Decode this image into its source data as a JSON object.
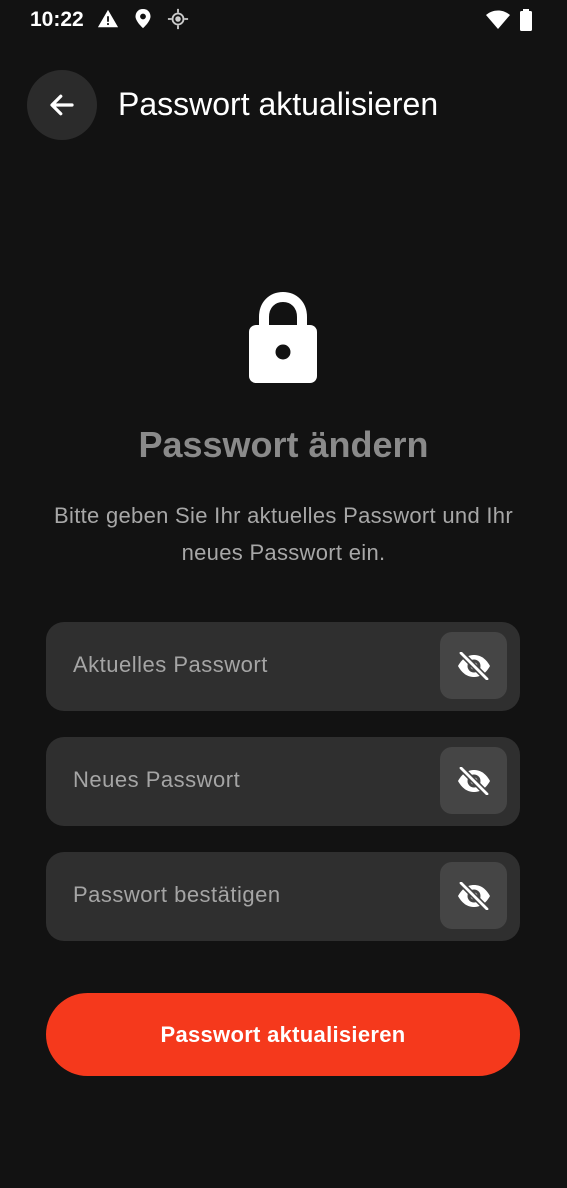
{
  "status_bar": {
    "time": "10:22",
    "left_icons": [
      "warning-icon",
      "location-pin-icon",
      "gps-icon"
    ],
    "right_icons": [
      "wifi-icon",
      "battery-icon"
    ]
  },
  "app_bar": {
    "back_icon": "arrow-left-icon",
    "title": "Passwort aktualisieren"
  },
  "hero": {
    "icon": "lock-icon",
    "heading": "Passwort ändern",
    "description": "Bitte geben Sie Ihr aktuelles Passwort und Ihr neues Passwort ein."
  },
  "form": {
    "fields": [
      {
        "placeholder": "Aktuelles Passwort",
        "toggle_icon": "eye-off-icon"
      },
      {
        "placeholder": "Neues Passwort",
        "toggle_icon": "eye-off-icon"
      },
      {
        "placeholder": "Passwort bestätigen",
        "toggle_icon": "eye-off-icon"
      }
    ],
    "submit_label": "Passwort aktualisieren"
  },
  "colors": {
    "background": "#121212",
    "surface": "#2f2f2f",
    "accent": "#f5391c"
  }
}
